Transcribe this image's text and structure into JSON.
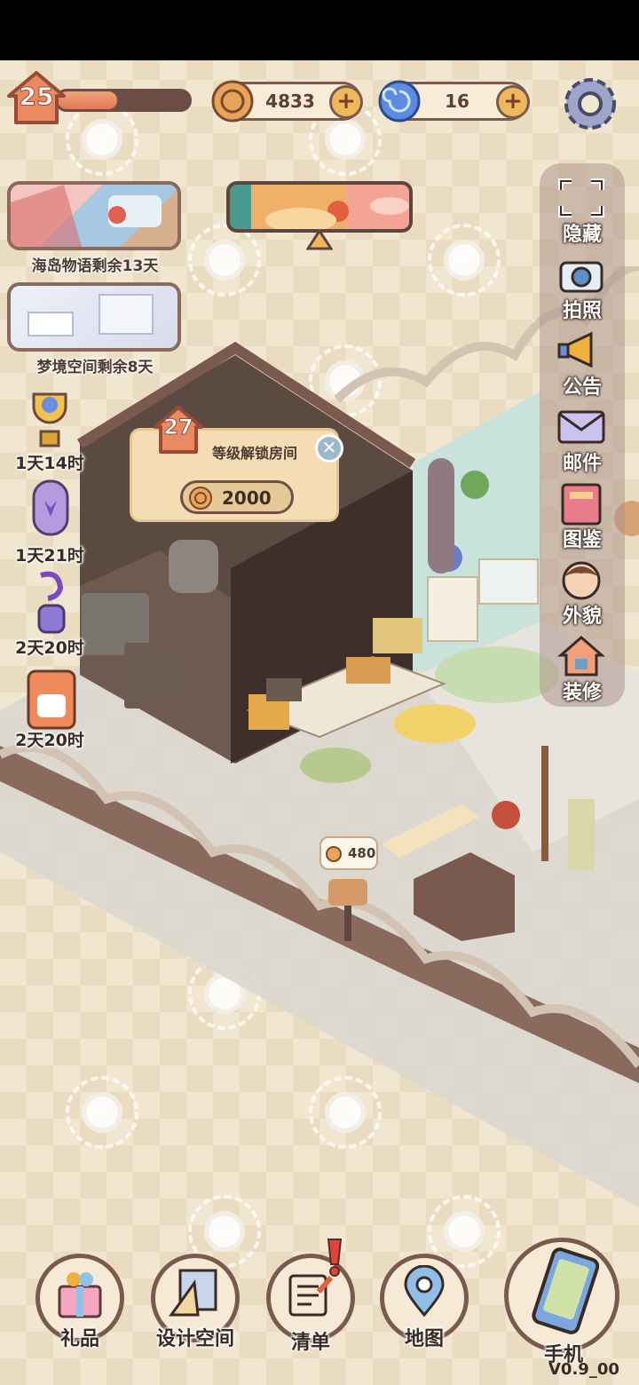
{
  "player": {
    "level": "25",
    "xp_fraction": 0.45
  },
  "currency": {
    "coins": {
      "amount": "4833",
      "icon": "coin-icon"
    },
    "gems": {
      "amount": "16",
      "icon": "swirl-gem-icon"
    }
  },
  "events": [
    {
      "label": "海岛物语剩余13天",
      "icon": "island-story-thumbnail"
    },
    {
      "label": "梦境空间剩余8天",
      "icon": "dream-space-thumbnail"
    }
  ],
  "timers": [
    {
      "label": "1天14时",
      "icon": "trophy-icon"
    },
    {
      "label": "1天21时",
      "icon": "butterfly-jar-icon"
    },
    {
      "label": "2天20时",
      "icon": "perfume-bottle-icon"
    },
    {
      "label": "2天20时",
      "icon": "cat-bag-icon"
    }
  ],
  "side_menu": [
    {
      "label": "隐藏",
      "icon": "hide-frame-icon"
    },
    {
      "label": "拍照",
      "icon": "camera-icon"
    },
    {
      "label": "公告",
      "icon": "megaphone-icon"
    },
    {
      "label": "邮件",
      "icon": "mail-icon"
    },
    {
      "label": "图鉴",
      "icon": "catalog-book-icon"
    },
    {
      "label": "外貌",
      "icon": "avatar-icon"
    },
    {
      "label": "装修",
      "icon": "renovate-house-icon"
    }
  ],
  "unlock_popup": {
    "level": "27",
    "title": "等级解锁房间",
    "cost": "2000"
  },
  "mailbox": {
    "amount": "480"
  },
  "bottom_bar": [
    {
      "label": "礼品",
      "icon": "gift-icon"
    },
    {
      "label": "设计空间",
      "icon": "design-tools-icon"
    },
    {
      "label": "清单",
      "icon": "checklist-icon"
    },
    {
      "label": "地图",
      "icon": "map-pin-icon"
    },
    {
      "label": "手机",
      "icon": "phone-icon"
    }
  ],
  "version": "V0.9_00",
  "colors": {
    "accent": "#e07a55",
    "frame": "#7a5a4e",
    "panel": "#f4dcb4"
  }
}
